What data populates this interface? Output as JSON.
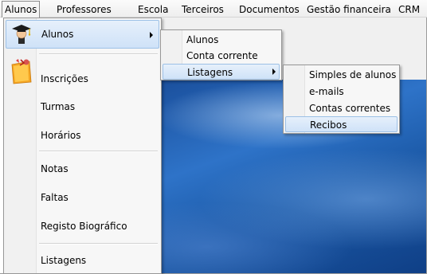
{
  "menubar": {
    "items": [
      "Alunos",
      "Professores",
      "Escola",
      "Terceiros",
      "Documentos",
      "Gestão financeira",
      "CRM"
    ]
  },
  "menu_alunos": {
    "items": [
      "Alunos",
      "Inscrições",
      "Turmas",
      "Horários",
      "Notas",
      "Faltas",
      "Registo Biográfico",
      "Listagens"
    ],
    "icons": [
      "student-graduation-icon",
      "registration-folder-icon"
    ]
  },
  "submenu_alunos": {
    "items": [
      "Alunos",
      "Conta corrente",
      "Listagens"
    ]
  },
  "submenu_listagens": {
    "items": [
      "Simples de alunos",
      "e-mails",
      "Contas correntes",
      "Recibos"
    ]
  },
  "colors": {
    "highlight": "#cfe2f8",
    "desktop": "#1c5aa8"
  }
}
